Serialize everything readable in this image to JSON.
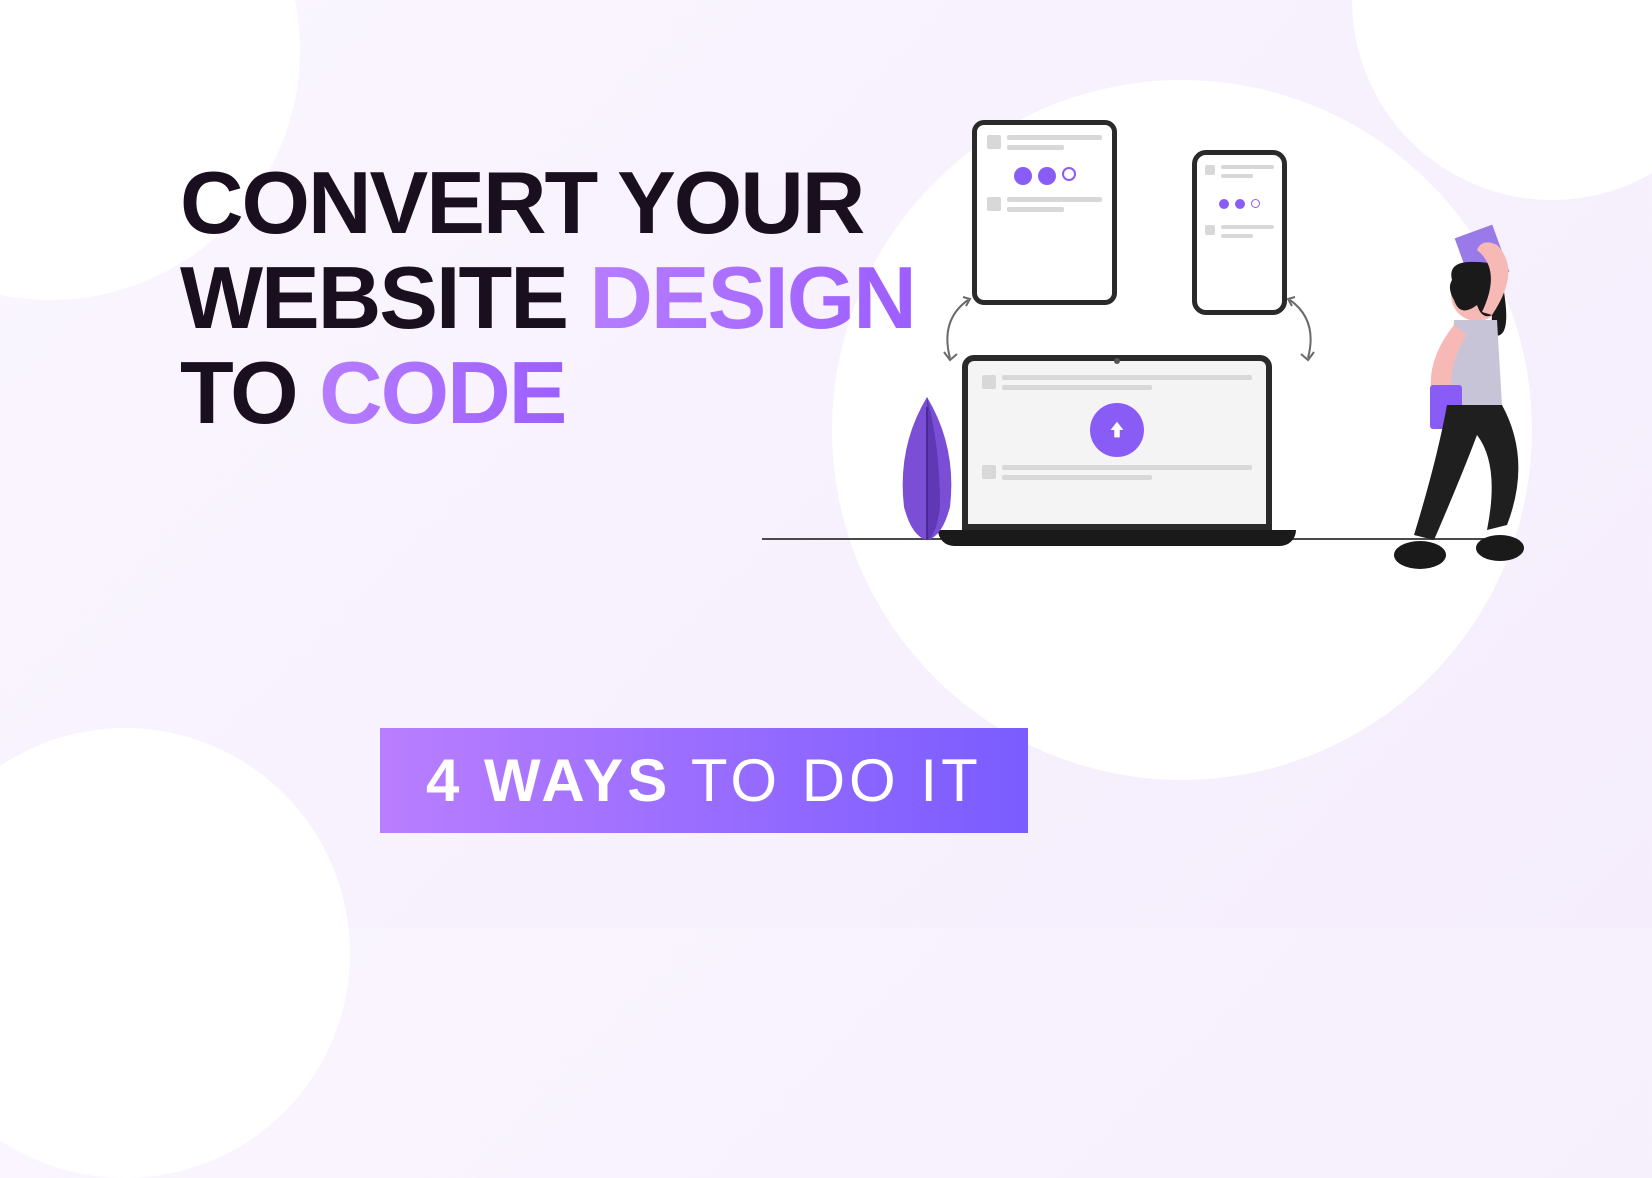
{
  "headline": {
    "line1_part1": "Convert your",
    "line2_part1": "website ",
    "line2_accent": "design",
    "line3_part1": "to ",
    "line3_accent": "code"
  },
  "banner": {
    "bold": "4 ways",
    "rest": " to do it"
  },
  "illustration": {
    "tablet_label": "tablet-mockup",
    "phone_label": "phone-mockup",
    "laptop_label": "laptop-mockup",
    "upload_icon": "upload-arrow-icon",
    "leaf_icon": "leaf-icon",
    "person_icon": "person-holding-device-icon"
  },
  "colors": {
    "accent_purple": "#8a5cf6",
    "gradient_start": "#b97eff",
    "gradient_end": "#7a5cff",
    "dark": "#1a0f1f"
  }
}
